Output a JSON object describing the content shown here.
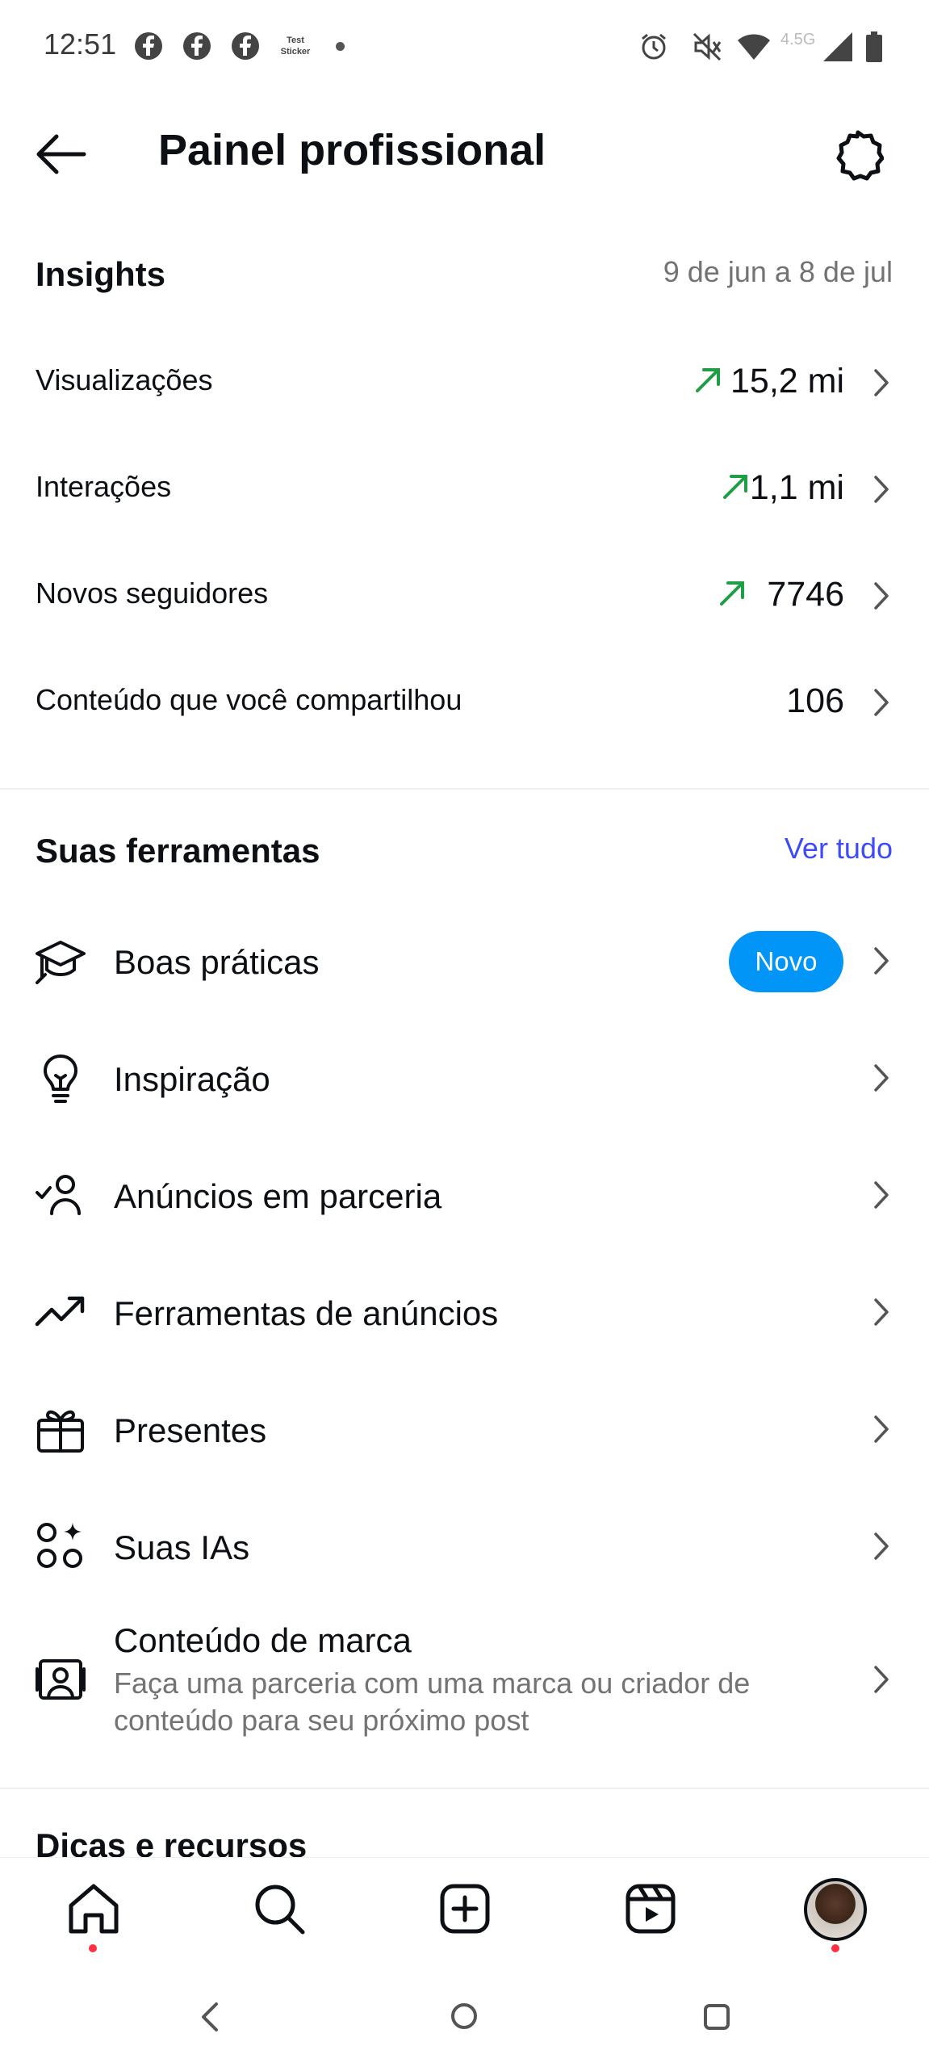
{
  "status_bar": {
    "time": "12:51",
    "network": "4.5G",
    "sticker_text": "Test Sticker",
    "icons": [
      "facebook-icon",
      "facebook-icon",
      "facebook-icon",
      "sticker-icon",
      "dot-icon",
      "alarm-icon",
      "mute-icon",
      "wifi-icon",
      "signal-icon",
      "battery-icon"
    ]
  },
  "header": {
    "title": "Painel profissional",
    "back_icon": "arrow-left-icon",
    "settings_icon": "gear-icon"
  },
  "insights": {
    "title": "Insights",
    "date_range": "9 de jun a 8 de jul",
    "rows": [
      {
        "label": "Visualizações",
        "value": "15,2 mi",
        "trend": "up"
      },
      {
        "label": "Interações",
        "value": "1,1 mi",
        "trend": "up"
      },
      {
        "label": "Novos seguidores",
        "value": "7746",
        "trend": "up"
      },
      {
        "label": "Conteúdo que você compartilhou",
        "value": "106",
        "trend": "none"
      }
    ]
  },
  "tools": {
    "title": "Suas ferramentas",
    "see_all": "Ver tudo",
    "items": [
      {
        "label": "Boas práticas",
        "icon": "graduation-cap-icon",
        "badge": "Novo"
      },
      {
        "label": "Inspiração",
        "icon": "lightbulb-icon"
      },
      {
        "label": "Anúncios em parceria",
        "icon": "person-check-icon"
      },
      {
        "label": "Ferramentas de anúncios",
        "icon": "trending-up-icon"
      },
      {
        "label": "Presentes",
        "icon": "gift-icon"
      },
      {
        "label": "Suas IAs",
        "icon": "ai-sparkle-icon"
      },
      {
        "label": "Conteúdo de marca",
        "icon": "branded-content-icon",
        "subtitle": "Faça uma parceria com uma marca ou criador de conteúdo para seu próximo post"
      }
    ]
  },
  "next_section": {
    "title": "Dicas e recursos"
  },
  "bottom_nav": {
    "items": [
      "home-icon",
      "search-icon",
      "create-icon",
      "reels-icon",
      "profile-avatar"
    ]
  },
  "colors": {
    "accent_blue": "#0095f6",
    "link_blue": "#3f4cf5",
    "trend_green": "#1f9e46",
    "notification_red": "#ff3040"
  }
}
